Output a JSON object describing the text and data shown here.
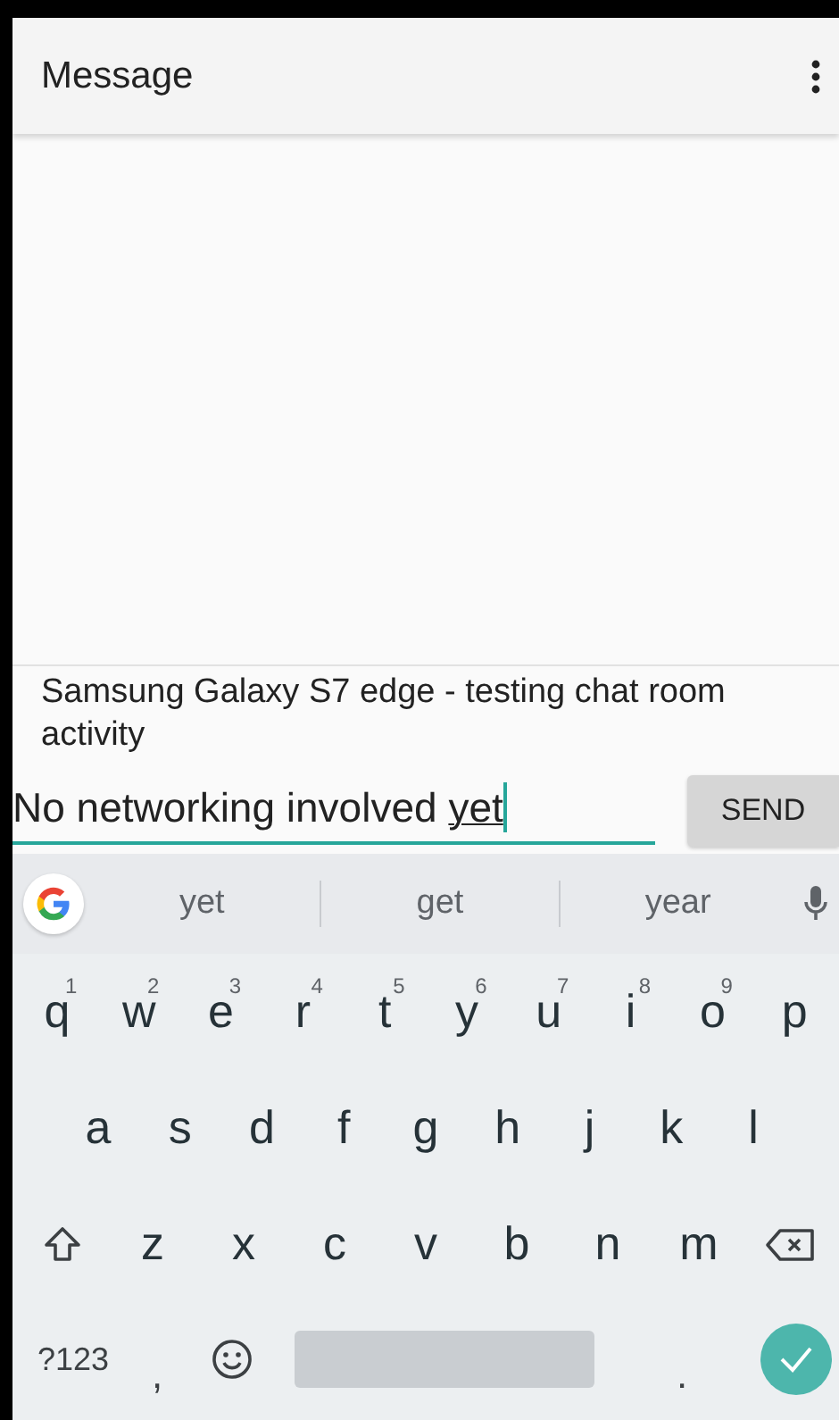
{
  "app_bar": {
    "title": "Message"
  },
  "message": "Samsung Galaxy S7 edge - testing chat room activity",
  "compose": {
    "value": "No networking involved ",
    "composing": "yet",
    "send_label": "SEND"
  },
  "suggestions": [
    "yet",
    "get",
    "year"
  ],
  "keyboard": {
    "rows": [
      [
        {
          "label": "q",
          "hint": "1"
        },
        {
          "label": "w",
          "hint": "2"
        },
        {
          "label": "e",
          "hint": "3"
        },
        {
          "label": "r",
          "hint": "4"
        },
        {
          "label": "t",
          "hint": "5"
        },
        {
          "label": "y",
          "hint": "6"
        },
        {
          "label": "u",
          "hint": "7"
        },
        {
          "label": "i",
          "hint": "8"
        },
        {
          "label": "o",
          "hint": "9"
        },
        {
          "label": "p"
        }
      ],
      [
        {
          "label": "a"
        },
        {
          "label": "s"
        },
        {
          "label": "d"
        },
        {
          "label": "f"
        },
        {
          "label": "g"
        },
        {
          "label": "h"
        },
        {
          "label": "j"
        },
        {
          "label": "k"
        },
        {
          "label": "l"
        }
      ],
      [
        {
          "kind": "shift"
        },
        {
          "label": "z"
        },
        {
          "label": "x"
        },
        {
          "label": "c"
        },
        {
          "label": "v"
        },
        {
          "label": "b"
        },
        {
          "label": "n"
        },
        {
          "label": "m"
        },
        {
          "kind": "backspace"
        }
      ]
    ],
    "bottom": [
      {
        "kind": "symbols",
        "label": "?123"
      },
      {
        "kind": "char",
        "label": ","
      },
      {
        "kind": "emoji"
      },
      {
        "kind": "space"
      },
      {
        "kind": "char",
        "label": "."
      },
      {
        "kind": "enter"
      }
    ]
  }
}
